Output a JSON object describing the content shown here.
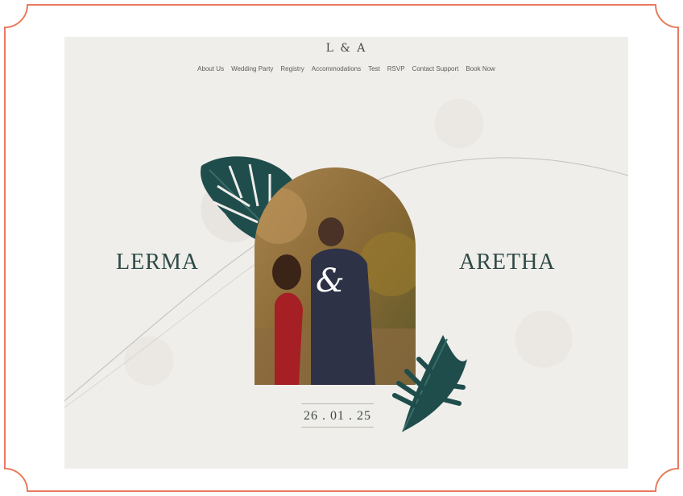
{
  "site": {
    "monogram": "L & A",
    "nav": {
      "items": [
        "About Us",
        "Wedding Party",
        "Registry",
        "Accommodations",
        "Test",
        "RSVP",
        "Contact Support",
        "Book Now"
      ]
    },
    "hero": {
      "name_left": "LERMA",
      "name_right": "ARETHA",
      "ampersand": "&",
      "date": "26 . 01 . 25"
    }
  },
  "colors": {
    "frame": "#e97a5f",
    "background": "#efeeea",
    "leaf": "#1f4d4c",
    "name_text": "#2f4a47"
  },
  "icons": {
    "top_leaf": "monstera-leaf-icon",
    "bottom_leaf": "palm-leaf-icon"
  }
}
